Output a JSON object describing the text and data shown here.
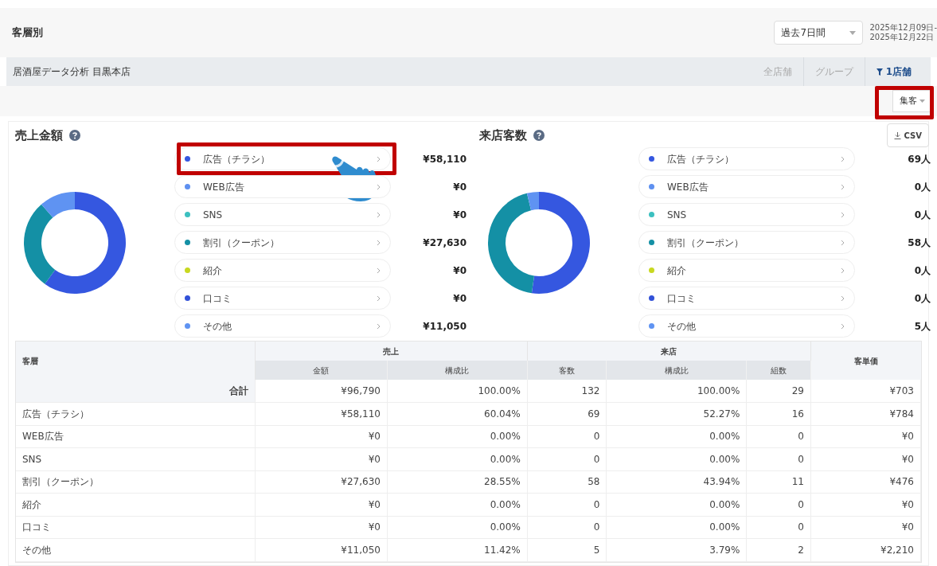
{
  "header": {
    "title": "客層別",
    "period_select": {
      "value": "過去7日間"
    },
    "date_range": [
      "2025年12月09日-",
      "2025年12月22日"
    ]
  },
  "store_bar": {
    "store": "居酒屋データ分析 目黒本店",
    "tabs": [
      {
        "label": "全店舗",
        "selected": false
      },
      {
        "label": "グループ",
        "selected": false
      },
      {
        "label": "1店舗",
        "selected": true
      }
    ]
  },
  "category_select": {
    "value": "集客",
    "highlighted": true
  },
  "panels": [
    {
      "title": "売上金額",
      "chart_data": {
        "type": "donut",
        "categories": [
          "広告（チラシ）",
          "WEB広告",
          "SNS",
          "割引（クーポン）",
          "紹介",
          "口コミ",
          "その他"
        ],
        "values": [
          60.04,
          0,
          0,
          28.55,
          0,
          0,
          11.41
        ]
      },
      "items": [
        {
          "value": "¥58,110",
          "color": "#3557e0",
          "highlighted": true
        },
        {
          "value": "¥0",
          "color": "#5e90f0",
          "highlighted": false
        },
        {
          "value": "¥0",
          "color": "#3cc0c0",
          "highlighted": false
        },
        {
          "value": "¥27,630",
          "color": "#1490a5",
          "highlighted": false
        },
        {
          "value": "¥0",
          "color": "#c8d820",
          "highlighted": false
        },
        {
          "value": "¥0",
          "color": "#3251d8",
          "highlighted": false
        },
        {
          "value": "¥11,050",
          "color": "#5f93f2",
          "highlighted": false
        }
      ]
    },
    {
      "title": "来店客数",
      "csv_button": "CSV",
      "chart_data": {
        "type": "donut",
        "categories": [
          "広告（チラシ）",
          "WEB広告",
          "SNS",
          "割引（クーポン）",
          "紹介",
          "口コミ",
          "その他"
        ],
        "values": [
          52.27,
          0,
          0,
          43.94,
          0,
          0,
          3.79
        ]
      },
      "items": [
        {
          "value": "69人",
          "color": "#3557e0",
          "highlighted": false
        },
        {
          "value": "0人",
          "color": "#5e90f0",
          "highlighted": false
        },
        {
          "value": "0人",
          "color": "#3cc0c0",
          "highlighted": false
        },
        {
          "value": "58人",
          "color": "#1490a5",
          "highlighted": false
        },
        {
          "value": "0人",
          "color": "#c8d820",
          "highlighted": false
        },
        {
          "value": "0人",
          "color": "#3251d8",
          "highlighted": false
        },
        {
          "value": "5人",
          "color": "#5f93f2",
          "highlighted": false
        }
      ]
    }
  ],
  "table": {
    "first_column": "客層",
    "groups": [
      {
        "label": "売上",
        "columns": [
          "金額",
          "構成比"
        ]
      },
      {
        "label": "来店",
        "columns": [
          "客数",
          "構成比",
          "組数"
        ]
      }
    ],
    "last_column": "客単価",
    "total_row": [
      "合計",
      "¥96,790",
      "100.00%",
      "132",
      "100.00%",
      "29",
      "¥703"
    ],
    "rows": [
      [
        "広告（チラシ）",
        "¥58,110",
        "60.04%",
        "69",
        "52.27%",
        "16",
        "¥784"
      ],
      [
        "WEB広告",
        "¥0",
        "0.00%",
        "0",
        "0.00%",
        "0",
        "¥0"
      ],
      [
        "SNS",
        "¥0",
        "0.00%",
        "0",
        "0.00%",
        "0",
        "¥0"
      ],
      [
        "割引（クーポン）",
        "¥27,630",
        "28.55%",
        "58",
        "43.94%",
        "11",
        "¥476"
      ],
      [
        "紹介",
        "¥0",
        "0.00%",
        "0",
        "0.00%",
        "0",
        "¥0"
      ],
      [
        "口コミ",
        "¥0",
        "0.00%",
        "0",
        "0.00%",
        "0",
        "¥0"
      ],
      [
        "その他",
        "¥11,050",
        "11.42%",
        "5",
        "3.79%",
        "2",
        "¥2,210"
      ]
    ]
  }
}
